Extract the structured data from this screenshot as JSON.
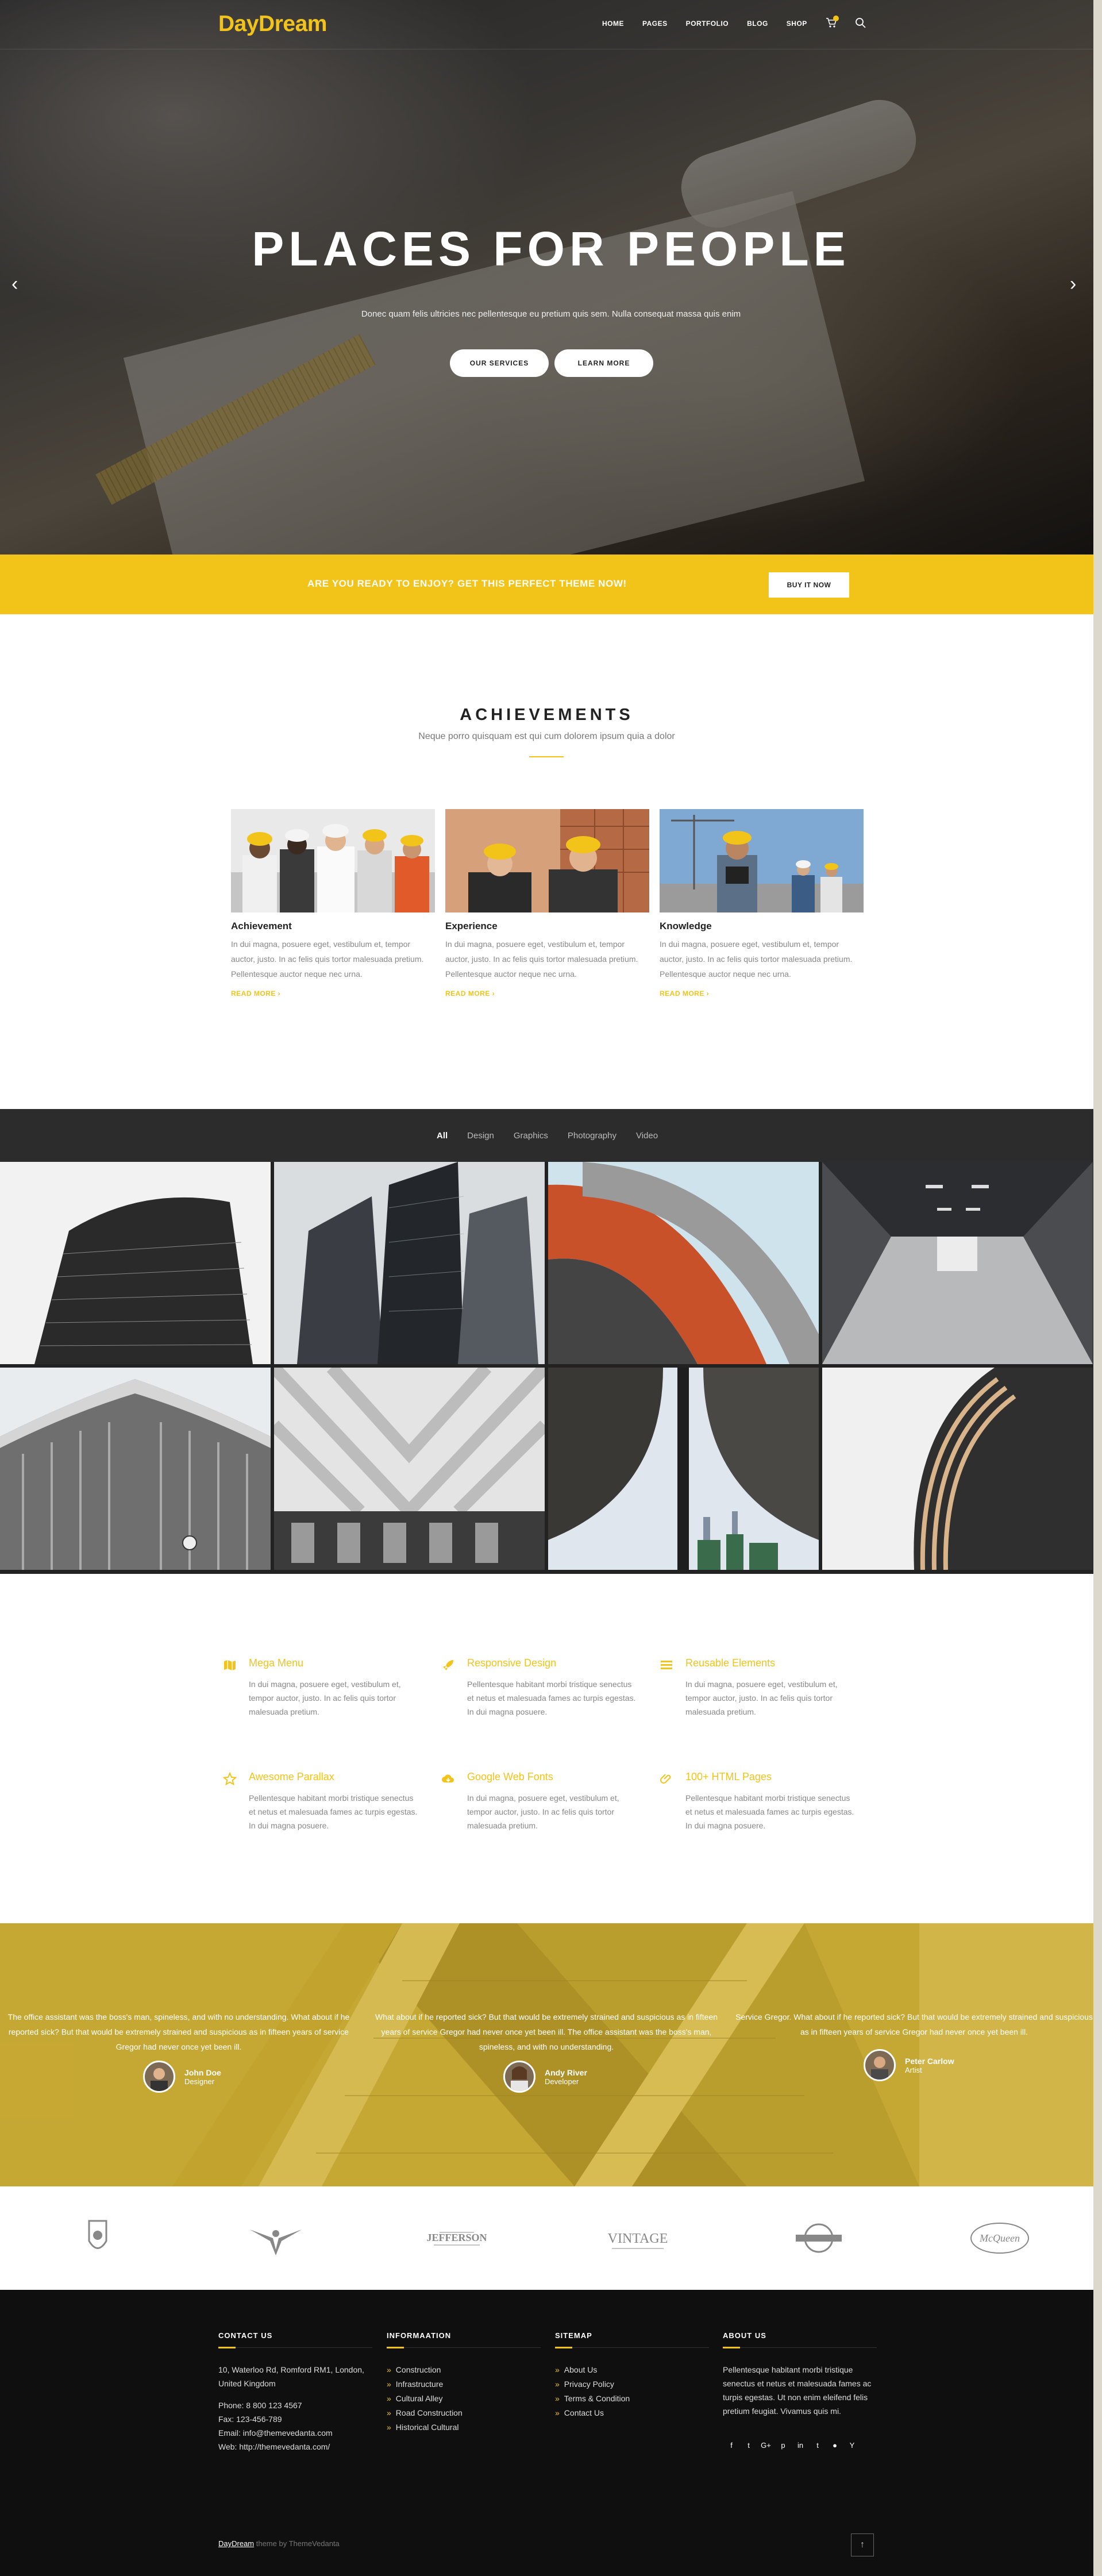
{
  "brand": {
    "logo": "DayDream",
    "accent": "#f2c318"
  },
  "nav": {
    "items": [
      "HOME",
      "PAGES",
      "PORTFOLIO",
      "BLOG",
      "SHOP"
    ]
  },
  "icons": {
    "cart": "cart-icon",
    "search": "search-icon",
    "prev": "chevron-left-icon",
    "next": "chevron-right-icon"
  },
  "hero": {
    "title": "PLACES FOR PEOPLE",
    "subtitle": "Donec quam felis ultricies nec pellentesque eu pretium quis sem. Nulla consequat massa quis enim",
    "btn_primary": "OUR SERVICES",
    "btn_secondary": "LEARN MORE"
  },
  "cta": {
    "text": "ARE YOU READY TO ENJOY? GET THIS PERFECT THEME NOW!",
    "button": "BUY IT NOW"
  },
  "achievements": {
    "title": "ACHIEVEMENTS",
    "subtitle": "Neque porro quisquam est qui cum dolorem ipsum quia a dolor",
    "cards": [
      {
        "title": "Achievement",
        "text": "In dui magna, posuere eget, vestibulum et, tempor auctor, justo. In ac felis quis tortor malesuada pretium. Pellentesque auctor neque nec urna.",
        "more": "READ MORE ›"
      },
      {
        "title": "Experience",
        "text": "In dui magna, posuere eget, vestibulum et, tempor auctor, justo. In ac felis quis tortor malesuada pretium. Pellentesque auctor neque nec urna.",
        "more": "READ MORE ›"
      },
      {
        "title": "Knowledge",
        "text": "In dui magna, posuere eget, vestibulum et, tempor auctor, justo. In ac felis quis tortor malesuada pretium. Pellentesque auctor neque nec urna.",
        "more": "READ MORE ›"
      }
    ]
  },
  "portfolio": {
    "tabs": [
      "All",
      "Design",
      "Graphics",
      "Photography",
      "Video"
    ],
    "active": "All"
  },
  "features": [
    {
      "icon": "map-icon",
      "title": "Mega Menu",
      "text": "In dui magna, posuere eget, vestibulum et, tempor auctor, justo. In ac felis quis tortor malesuada pretium."
    },
    {
      "icon": "rocket-icon",
      "title": "Responsive Design",
      "text": "Pellentesque habitant morbi tristique senectus et netus et malesuada fames ac turpis egestas. In dui magna posuere."
    },
    {
      "icon": "list-icon",
      "title": "Reusable Elements",
      "text": "In dui magna, posuere eget, vestibulum et, tempor auctor, justo. In ac felis quis tortor malesuada pretium."
    },
    {
      "icon": "star-icon",
      "title": "Awesome Parallax",
      "text": "Pellentesque habitant morbi tristique senectus et netus et malesuada fames ac turpis egestas. In dui magna posuere."
    },
    {
      "icon": "cloud-download-icon",
      "title": "Google Web Fonts",
      "text": "In dui magna, posuere eget, vestibulum et, tempor auctor, justo. In ac felis quis tortor malesuada pretium."
    },
    {
      "icon": "paperclip-icon",
      "title": "100+ HTML Pages",
      "text": "Pellentesque habitant morbi tristique senectus et netus et malesuada fames ac turpis egestas. In dui magna posuere."
    }
  ],
  "testimonials": [
    {
      "quote": "The office assistant was the boss's man, spineless, and with no understanding. What about if he reported sick? But that would be extremely strained and suspicious as in fifteen years of service Gregor had never once yet been ill.",
      "name": "John Doe",
      "role": "Designer"
    },
    {
      "quote": "What about if he reported sick? But that would be extremely strained and suspicious as in fifteen years of service Gregor had never once yet been ill. The office assistant was the boss's man, spineless, and with no understanding.",
      "name": "Andy River",
      "role": "Developer"
    },
    {
      "quote": "Service Gregor. What about if he reported sick? But that would be extremely strained and suspicious as in fifteen years of service Gregor had never once yet been ill.",
      "name": "Peter Carlow",
      "role": "Artist"
    }
  ],
  "clients": [
    "client-logo-shield",
    "client-logo-eagle",
    "JEFFERSON",
    "VINTAGE",
    "client-logo-badge",
    "McQueen"
  ],
  "footer": {
    "contact": {
      "title": "CONTACT US",
      "address": "10, Waterloo Rd, Romford RM1, London, United Kingdom",
      "phone": "Phone: 8 800 123 4567",
      "fax": "Fax: 123-456-789",
      "email": "Email: info@themevedanta.com",
      "web": "Web: http://themevedanta.com/"
    },
    "info": {
      "title": "INFORMAATION",
      "items": [
        "Construction",
        "Infrastructure",
        "Cultural Alley",
        "Road Construction",
        "Historical Cultural"
      ]
    },
    "sitemap": {
      "title": "SITEMAP",
      "items": [
        "About Us",
        "Privacy Policy",
        "Terms & Condition",
        "Contact Us"
      ]
    },
    "about": {
      "title": "ABOUT US",
      "text": "Pellentesque habitant morbi tristique senectus et netus et malesuada fames ac turpis egestas. Ut non enim eleifend felis pretium feugiat. Vivamus quis mi."
    },
    "socials": [
      "f",
      "t",
      "G+",
      "p",
      "in",
      "t",
      "●",
      "Y"
    ],
    "copyright_link": "DayDream",
    "copyright_rest": " theme by ThemeVedanta",
    "totop": "↑"
  }
}
